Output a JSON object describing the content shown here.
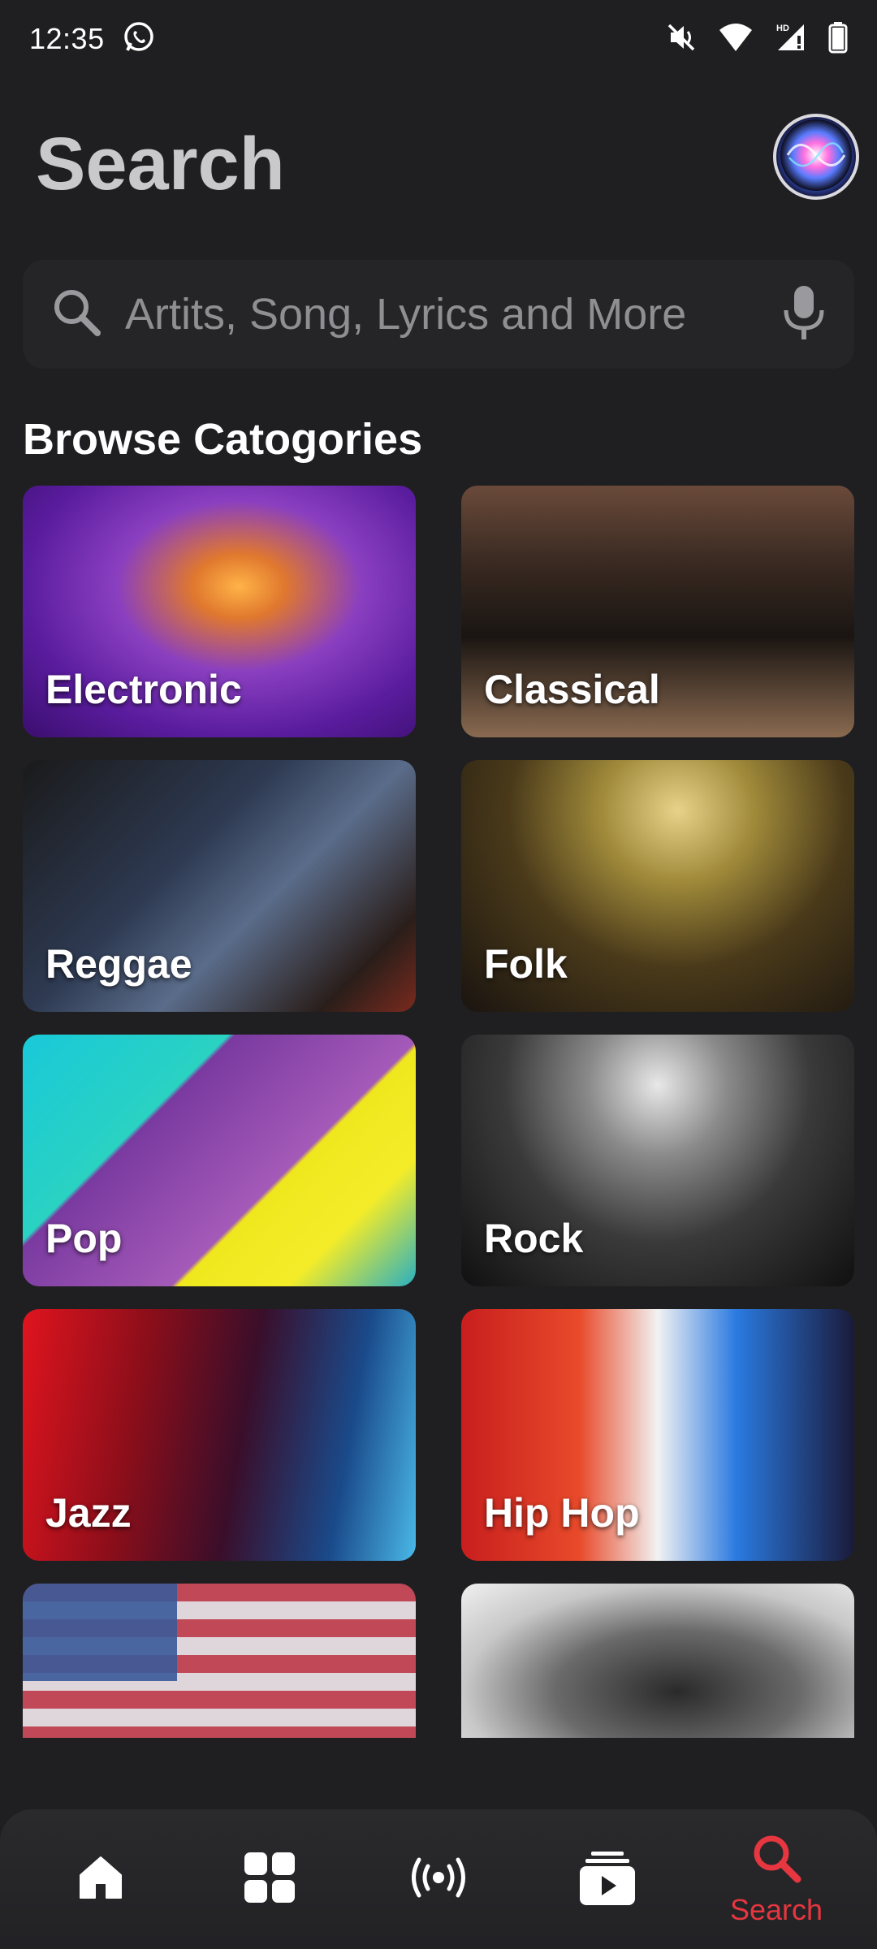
{
  "status_bar": {
    "time": "12:35",
    "icons": [
      "whatsapp-icon",
      "mute-icon",
      "wifi-icon",
      "signal-icon",
      "battery-icon"
    ]
  },
  "header": {
    "title": "Search",
    "assistant_icon": "siri-icon"
  },
  "search": {
    "placeholder": "Artits, Song, Lyrics and More",
    "value": ""
  },
  "browse": {
    "heading": "Browse Catogories",
    "categories": [
      {
        "label": "Electronic"
      },
      {
        "label": "Classical"
      },
      {
        "label": "Reggae"
      },
      {
        "label": "Folk"
      },
      {
        "label": "Pop"
      },
      {
        "label": "Rock"
      },
      {
        "label": "Jazz"
      },
      {
        "label": "Hip Hop"
      },
      {
        "label": ""
      },
      {
        "label": ""
      }
    ]
  },
  "bottom_nav": {
    "items": [
      {
        "icon": "home-icon",
        "label": ""
      },
      {
        "icon": "grid-icon",
        "label": ""
      },
      {
        "icon": "radio-icon",
        "label": ""
      },
      {
        "icon": "library-icon",
        "label": ""
      },
      {
        "icon": "search-icon",
        "label": "Search",
        "active": true
      }
    ]
  },
  "colors": {
    "background": "#1f1f21",
    "accent": "#e6363f",
    "title": "#c9c9cb",
    "search_field": "#252528"
  }
}
